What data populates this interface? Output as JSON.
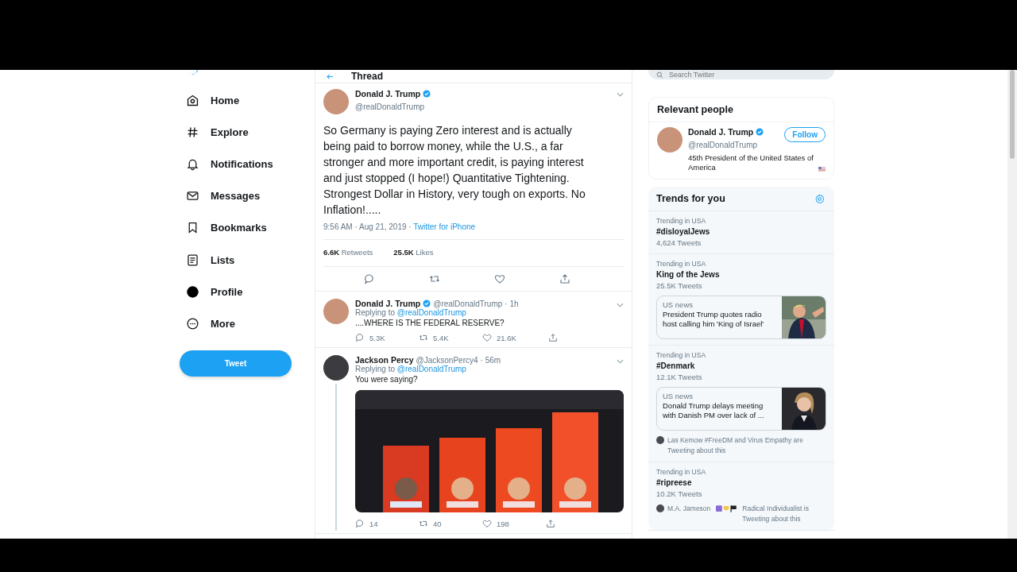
{
  "nav": {
    "items": [
      {
        "kind": "home",
        "label": "Home"
      },
      {
        "kind": "explore",
        "label": "Explore"
      },
      {
        "kind": "notifications",
        "label": "Notifications"
      },
      {
        "kind": "messages",
        "label": "Messages"
      },
      {
        "kind": "bookmarks",
        "label": "Bookmarks"
      },
      {
        "kind": "lists",
        "label": "Lists"
      },
      {
        "kind": "profile",
        "label": "Profile"
      },
      {
        "kind": "more",
        "label": "More"
      }
    ],
    "tweet_button": "Tweet"
  },
  "thread": {
    "title": "Thread",
    "main": {
      "name": "Donald J. Trump",
      "verified": true,
      "handle": "@realDonaldTrump",
      "text": "So Germany is paying Zero interest and is actually being paid to borrow money, while the U.S., a far stronger and more important credit, is paying interest and just stopped (I hope!) Quantitative Tightening. Strongest Dollar in History, very tough on exports. No Inflation!.....",
      "time": "9:56 AM · Aug 21, 2019 ·",
      "source": "Twitter for iPhone",
      "stats": [
        {
          "value": "6.6K",
          "label": "Retweets"
        },
        {
          "value": "25.5K",
          "label": "Likes"
        }
      ]
    },
    "replies": [
      {
        "name": "Donald J. Trump",
        "verified": true,
        "handle": "@realDonaldTrump",
        "time": "· 1h",
        "replying": "Replying to",
        "mention": "@realDonaldTrump",
        "text": "....WHERE IS THE FEDERAL RESERVE?",
        "replies": "5.3K",
        "retweets": "5.4K",
        "likes": "21.6K",
        "thread_line": false
      },
      {
        "name": "Jackson Percy",
        "verified": false,
        "handle": "@JacksonPercy4",
        "time": "· 56m",
        "replying": "Replying to",
        "mention": "@realDonaldTrump",
        "text": "You were saying?",
        "replies": "14",
        "retweets": "40",
        "likes": "198",
        "thread_line": true
      }
    ]
  },
  "sidebar": {
    "search": {
      "placeholder": "Search Twitter"
    },
    "relevant": {
      "title": "Relevant people",
      "person": {
        "name": "Donald J. Trump",
        "verified": true,
        "handle": "@realDonaldTrump",
        "bio": "45th President of the United States of America",
        "follow": "Follow"
      }
    },
    "trends": {
      "title": "Trends for you",
      "items": [
        {
          "context": "Trending in USA",
          "name": "#disloyalJews",
          "count": "4,624 Tweets"
        },
        {
          "context": "Trending in USA",
          "name": "King of the Jews",
          "count": "25.5K Tweets",
          "news": {
            "category": "US news",
            "headline": "President Trump quotes radio host calling him 'King of Israel'"
          }
        },
        {
          "context": "Trending in USA",
          "name": "#Denmark",
          "count": "12.1K Tweets",
          "news": {
            "category": "US news",
            "headline": "Donald Trump delays meeting with Danish PM over lack of ..."
          },
          "social": [
            "Las Kemow #FreeDM and Virus Empathy are Tweeting about this"
          ]
        },
        {
          "context": "Trending in USA",
          "name": "#ripreese",
          "count": "10.2K Tweets",
          "social": [
            "M.A. Jameson",
            "Radical Individualist is Tweeting about this"
          ]
        }
      ]
    }
  }
}
